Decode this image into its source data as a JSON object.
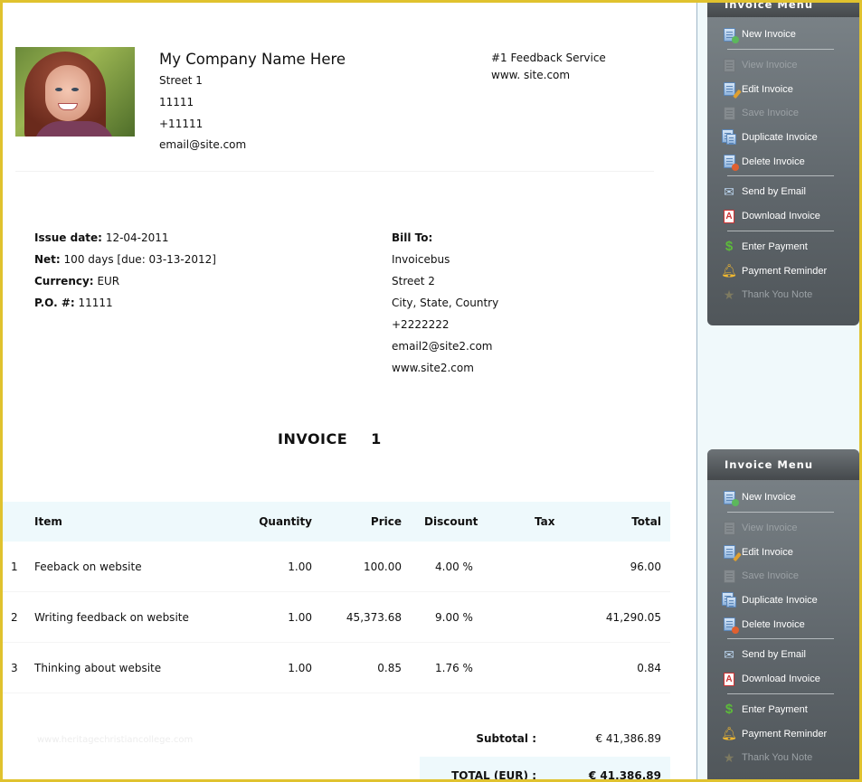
{
  "company": {
    "name": "My Company Name Here",
    "lines": [
      "Street 1",
      "11111",
      "+11111",
      "email@site.com"
    ],
    "tagline": "#1 Feedback Service",
    "website": "www. site.com"
  },
  "meta": {
    "issue_label": "Issue date:",
    "issue_value": "12-04-2011",
    "net_label": "Net:",
    "net_value": "100 days [due: 03-13-2012]",
    "currency_label": "Currency:",
    "currency_value": "EUR",
    "po_label": "P.O. #:",
    "po_value": "11111"
  },
  "bill_to": {
    "heading": "Bill To:",
    "lines": [
      "Invoicebus",
      "Street 2",
      "City, State, Country",
      "+2222222",
      "email2@site2.com",
      "www.site2.com"
    ]
  },
  "invoice": {
    "title": "INVOICE",
    "number": "1"
  },
  "table": {
    "headers": {
      "item": "Item",
      "quantity": "Quantity",
      "price": "Price",
      "discount": "Discount",
      "tax": "Tax",
      "total": "Total"
    },
    "rows": [
      {
        "num": "1",
        "item": "Feeback on website",
        "quantity": "1.00",
        "price": "100.00",
        "discount": "4.00 %",
        "tax": "",
        "total": "96.00"
      },
      {
        "num": "2",
        "item": "Writing feedback on website",
        "quantity": "1.00",
        "price": "45,373.68",
        "discount": "9.00 %",
        "tax": "",
        "total": "41,290.05"
      },
      {
        "num": "3",
        "item": "Thinking about website",
        "quantity": "1.00",
        "price": "0.85",
        "discount": "1.76 %",
        "tax": "",
        "total": "0.84"
      }
    ]
  },
  "totals": {
    "subtotal_label": "Subtotal :",
    "subtotal_value": "€ 41,386.89",
    "total_label": "TOTAL (EUR) :",
    "total_value": "€ 41,386.89"
  },
  "watermark": "www.heritagechristiancollege.com",
  "menu": {
    "title": "Invoice Menu",
    "items": [
      {
        "label": "New Invoice",
        "icon": "new-invoice-icon",
        "enabled": true
      },
      {
        "label": "View Invoice",
        "icon": "view-invoice-icon",
        "enabled": false
      },
      {
        "label": "Edit Invoice",
        "icon": "edit-invoice-icon",
        "enabled": true
      },
      {
        "label": "Save Invoice",
        "icon": "save-invoice-icon",
        "enabled": false
      },
      {
        "label": "Duplicate Invoice",
        "icon": "duplicate-invoice-icon",
        "enabled": true
      },
      {
        "label": "Delete Invoice",
        "icon": "delete-invoice-icon",
        "enabled": true
      },
      {
        "label": "Send by Email",
        "icon": "email-icon",
        "enabled": true
      },
      {
        "label": "Download Invoice",
        "icon": "pdf-icon",
        "enabled": true
      },
      {
        "label": "Enter Payment",
        "icon": "dollar-icon",
        "enabled": true
      },
      {
        "label": "Payment Reminder",
        "icon": "bell-icon",
        "enabled": true
      },
      {
        "label": "Thank You Note",
        "icon": "star-icon",
        "enabled": false
      }
    ]
  },
  "colors": {
    "frame": "#e0c22e",
    "table_header_bg": "#eef9fc",
    "menu_bg": "#5f666b",
    "menu_disabled_text": "#9ba1a5"
  }
}
